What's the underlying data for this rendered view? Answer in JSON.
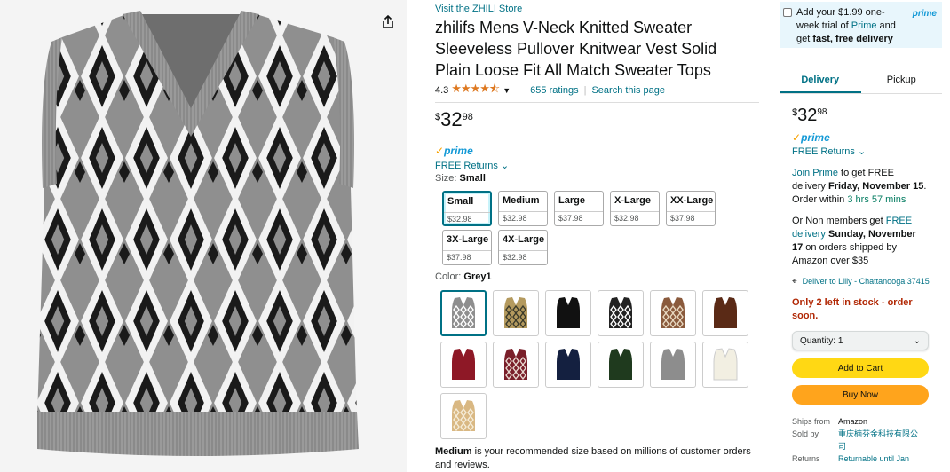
{
  "store_link": "Visit the ZHILI Store",
  "title": "zhilifs Mens V-Neck Knitted Sweater Sleeveless Pullover Knitwear Vest Solid Plain Loose Fit All Match Sweater Tops",
  "rating": {
    "value": "4.3",
    "stars": "★★★★⯪",
    "count_text": "655 ratings",
    "search_text": "Search this page"
  },
  "price": {
    "symbol": "$",
    "whole": "32",
    "fraction": "98"
  },
  "prime_label": "prime",
  "returns_label": "FREE Returns",
  "size": {
    "label": "Size:",
    "selected": "Small",
    "options": [
      {
        "name": "Small",
        "price": "$32.98"
      },
      {
        "name": "Medium",
        "price": "$32.98"
      },
      {
        "name": "Large",
        "price": "$37.98"
      },
      {
        "name": "X-Large",
        "price": "$32.98"
      },
      {
        "name": "XX-Large",
        "price": "$37.98"
      },
      {
        "name": "3X-Large",
        "price": "$37.98"
      },
      {
        "name": "4X-Large",
        "price": "$32.98"
      }
    ]
  },
  "color": {
    "label": "Color:",
    "selected": "Grey1",
    "swatches": [
      {
        "color": "#8e8e8e",
        "accent": "#ffffff",
        "pattern": "argyle"
      },
      {
        "color": "#b49a5e",
        "accent": "#3a3a2a",
        "pattern": "argyle"
      },
      {
        "color": "#111111",
        "accent": "#111111",
        "pattern": "solid"
      },
      {
        "color": "#222222",
        "accent": "#ffffff",
        "pattern": "argyle"
      },
      {
        "color": "#8a5a3c",
        "accent": "#e8d8c0",
        "pattern": "argyle"
      },
      {
        "color": "#5a2a16",
        "accent": "#5a2a16",
        "pattern": "solid"
      },
      {
        "color": "#8e1826",
        "accent": "#8e1826",
        "pattern": "solid"
      },
      {
        "color": "#7a1f2a",
        "accent": "#e8d8d0",
        "pattern": "argyle"
      },
      {
        "color": "#142040",
        "accent": "#142040",
        "pattern": "solid"
      },
      {
        "color": "#1f3a1e",
        "accent": "#1f3a1e",
        "pattern": "solid"
      },
      {
        "color": "#8d8d8d",
        "accent": "#8d8d8d",
        "pattern": "solid"
      },
      {
        "color": "#f2efe2",
        "accent": "#f2efe2",
        "pattern": "solid"
      },
      {
        "color": "#d9b883",
        "accent": "#f5ecd8",
        "pattern": "argyle"
      }
    ]
  },
  "recommendation": {
    "size": "Medium",
    "text": " is your recommended size based on millions of customer orders and reviews."
  },
  "buybox": {
    "prime_trial": {
      "prefix": "Add your $1.99 one-week trial of ",
      "prime_word": "Prime",
      "mid": " and get ",
      "bold": "fast, free delivery",
      "logo": "prime"
    },
    "tabs": [
      "Delivery",
      "Pickup"
    ],
    "price": {
      "symbol": "$",
      "whole": "32",
      "fraction": "98"
    },
    "prime_label": "prime",
    "returns_label": "FREE Returns",
    "join_prime": "Join Prime",
    "join_suffix": " to get FREE delivery ",
    "delivery_date": "Friday, November 15",
    "order_within_prefix": ". Order within ",
    "countdown": "3 hrs 57 mins",
    "nonmember_prefix": "Or Non members get ",
    "free_delivery_link": "FREE delivery",
    "nonmember_date": "Sunday, November 17",
    "nonmember_suffix": " on orders shipped by Amazon over $35",
    "deliver_to": "Deliver to Lilly - Chattanooga 37415",
    "stock": "Only 2 left in stock - order soon.",
    "quantity_label": "Quantity:",
    "quantity_value": "1",
    "add_to_cart": "Add to Cart",
    "buy_now": "Buy Now",
    "ships_from_label": "Ships from",
    "ships_from_value": "Amazon",
    "sold_by_label": "Sold by",
    "sold_by_value": "重庆楠芬金科技有限公司",
    "returns_label2": "Returns",
    "returns_value": "Returnable until Jan"
  }
}
